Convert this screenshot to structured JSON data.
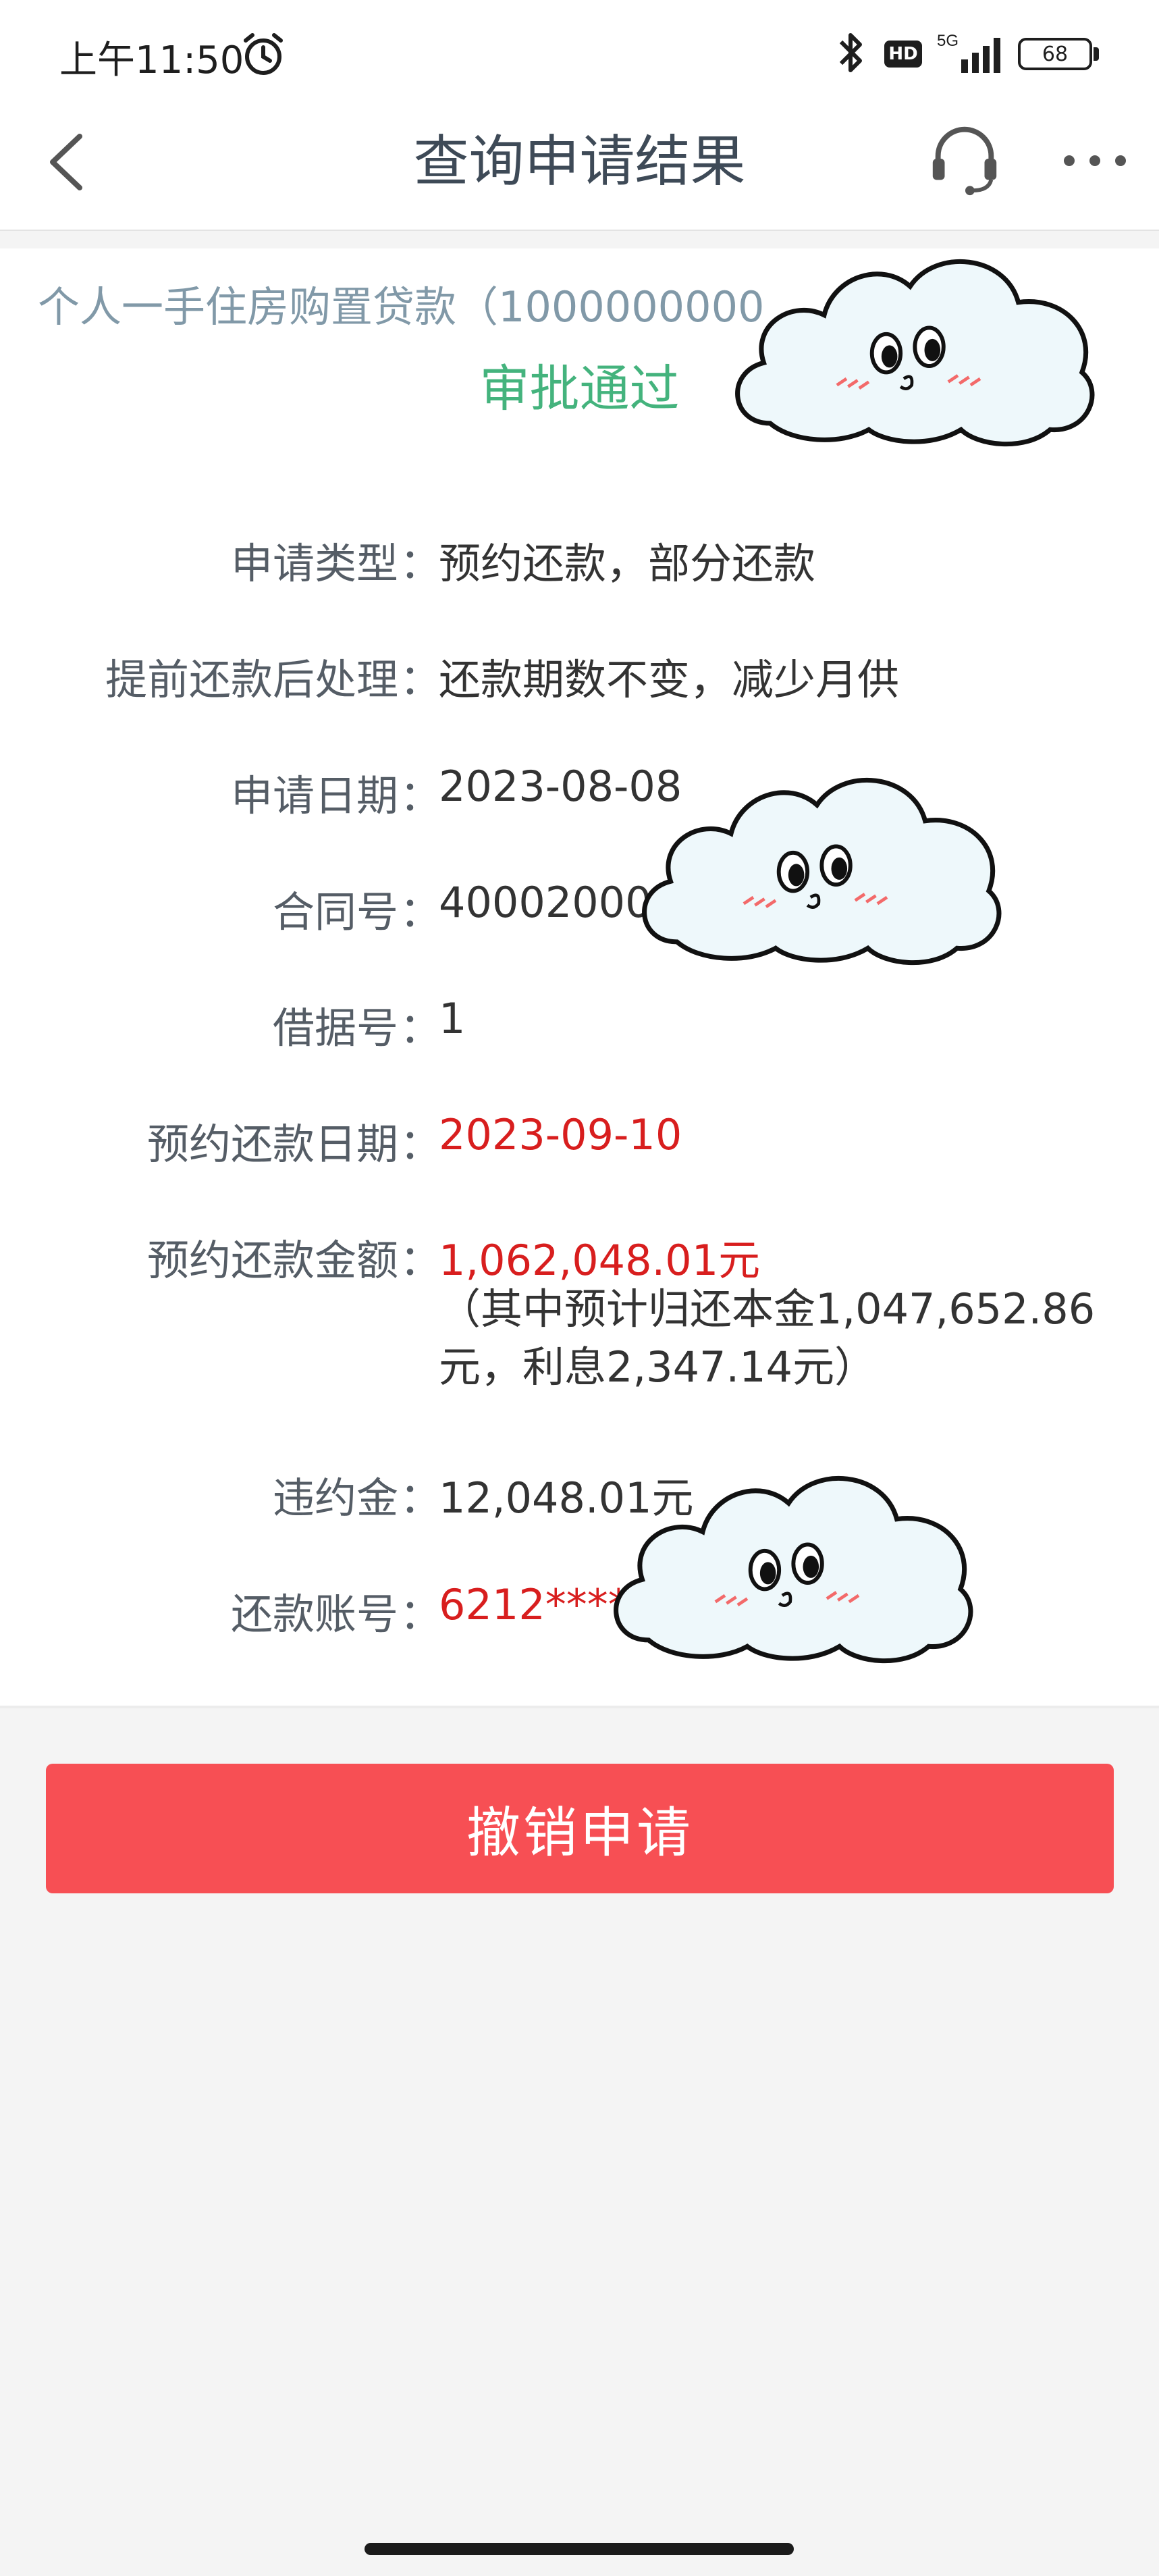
{
  "status_bar": {
    "time": "上午11:50",
    "network": "5G",
    "hd_badge": "HD",
    "battery": "68",
    "icons": [
      "alarm-icon",
      "bluetooth-icon",
      "signal-icon",
      "battery-icon"
    ]
  },
  "nav": {
    "title": "查询申请结果",
    "icons": [
      "back-icon",
      "headset-icon",
      "more-icon"
    ]
  },
  "loan": {
    "title_visible": "个人一手住房购置贷款（1000000000",
    "title_tail": "）",
    "status": "审批通过"
  },
  "details": [
    {
      "label": "申请类型",
      "value": "预约还款，部分还款"
    },
    {
      "label": "提前还款后处理",
      "value": "还款期数不变，减少月供"
    },
    {
      "label": "申请日期",
      "value": "2023-08-08"
    },
    {
      "label": "合同号",
      "value": "40002000"
    },
    {
      "label": "借据号",
      "value": "1"
    },
    {
      "label": "预约还款日期",
      "value": "2023-09-10"
    },
    {
      "label": "预约还款金额",
      "value": "1,062,048.01元",
      "note_line1": "（其中预计归还本金1,047,652.86",
      "note_line2": "元，利息2,347.14元）"
    },
    {
      "label": "违约金",
      "value": "12,048.01元"
    },
    {
      "label": "还款账号",
      "value": "6212****"
    }
  ],
  "colon": "：",
  "actions": {
    "cancel_label": "撤销申请"
  },
  "colors": {
    "approved": "#44b37d",
    "highlight_red": "#d81e1e",
    "button": "#f74f54"
  }
}
